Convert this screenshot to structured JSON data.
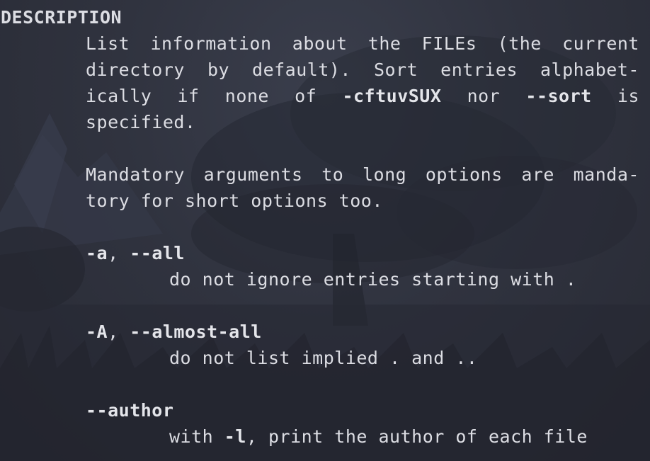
{
  "man": {
    "section": "DESCRIPTION",
    "description": {
      "line1": [
        "List",
        "information",
        "about",
        "the",
        "FILEs",
        "(the",
        "current"
      ],
      "line2": [
        "directory",
        "by",
        "default).",
        "Sort",
        "entries",
        "alphabet-"
      ],
      "line3": {
        "w1": "ically",
        "w2": "if",
        "w3": "none",
        "w4": "of",
        "flags": "-cftuvSUX",
        "w5": "nor",
        "sort": "--sort",
        "w6": "is"
      },
      "line4": "specified."
    },
    "mandatory": {
      "line1": [
        "Mandatory",
        "arguments",
        "to",
        "long",
        "options",
        "are",
        "manda-"
      ],
      "line2": "tory for short options too."
    },
    "options": [
      {
        "short": "-a",
        "sep": ", ",
        "long": "--all",
        "desc": "do not ignore entries starting with ."
      },
      {
        "short": "-A",
        "sep": ", ",
        "long": "--almost-all",
        "desc": "do not list implied . and .."
      },
      {
        "long": "--author",
        "desc_pre": "with ",
        "desc_flag": "-l",
        "desc_post": ", print the author of each file"
      }
    ]
  },
  "colors": {
    "background": "#2c2f3a",
    "text": "#dcdde3"
  }
}
